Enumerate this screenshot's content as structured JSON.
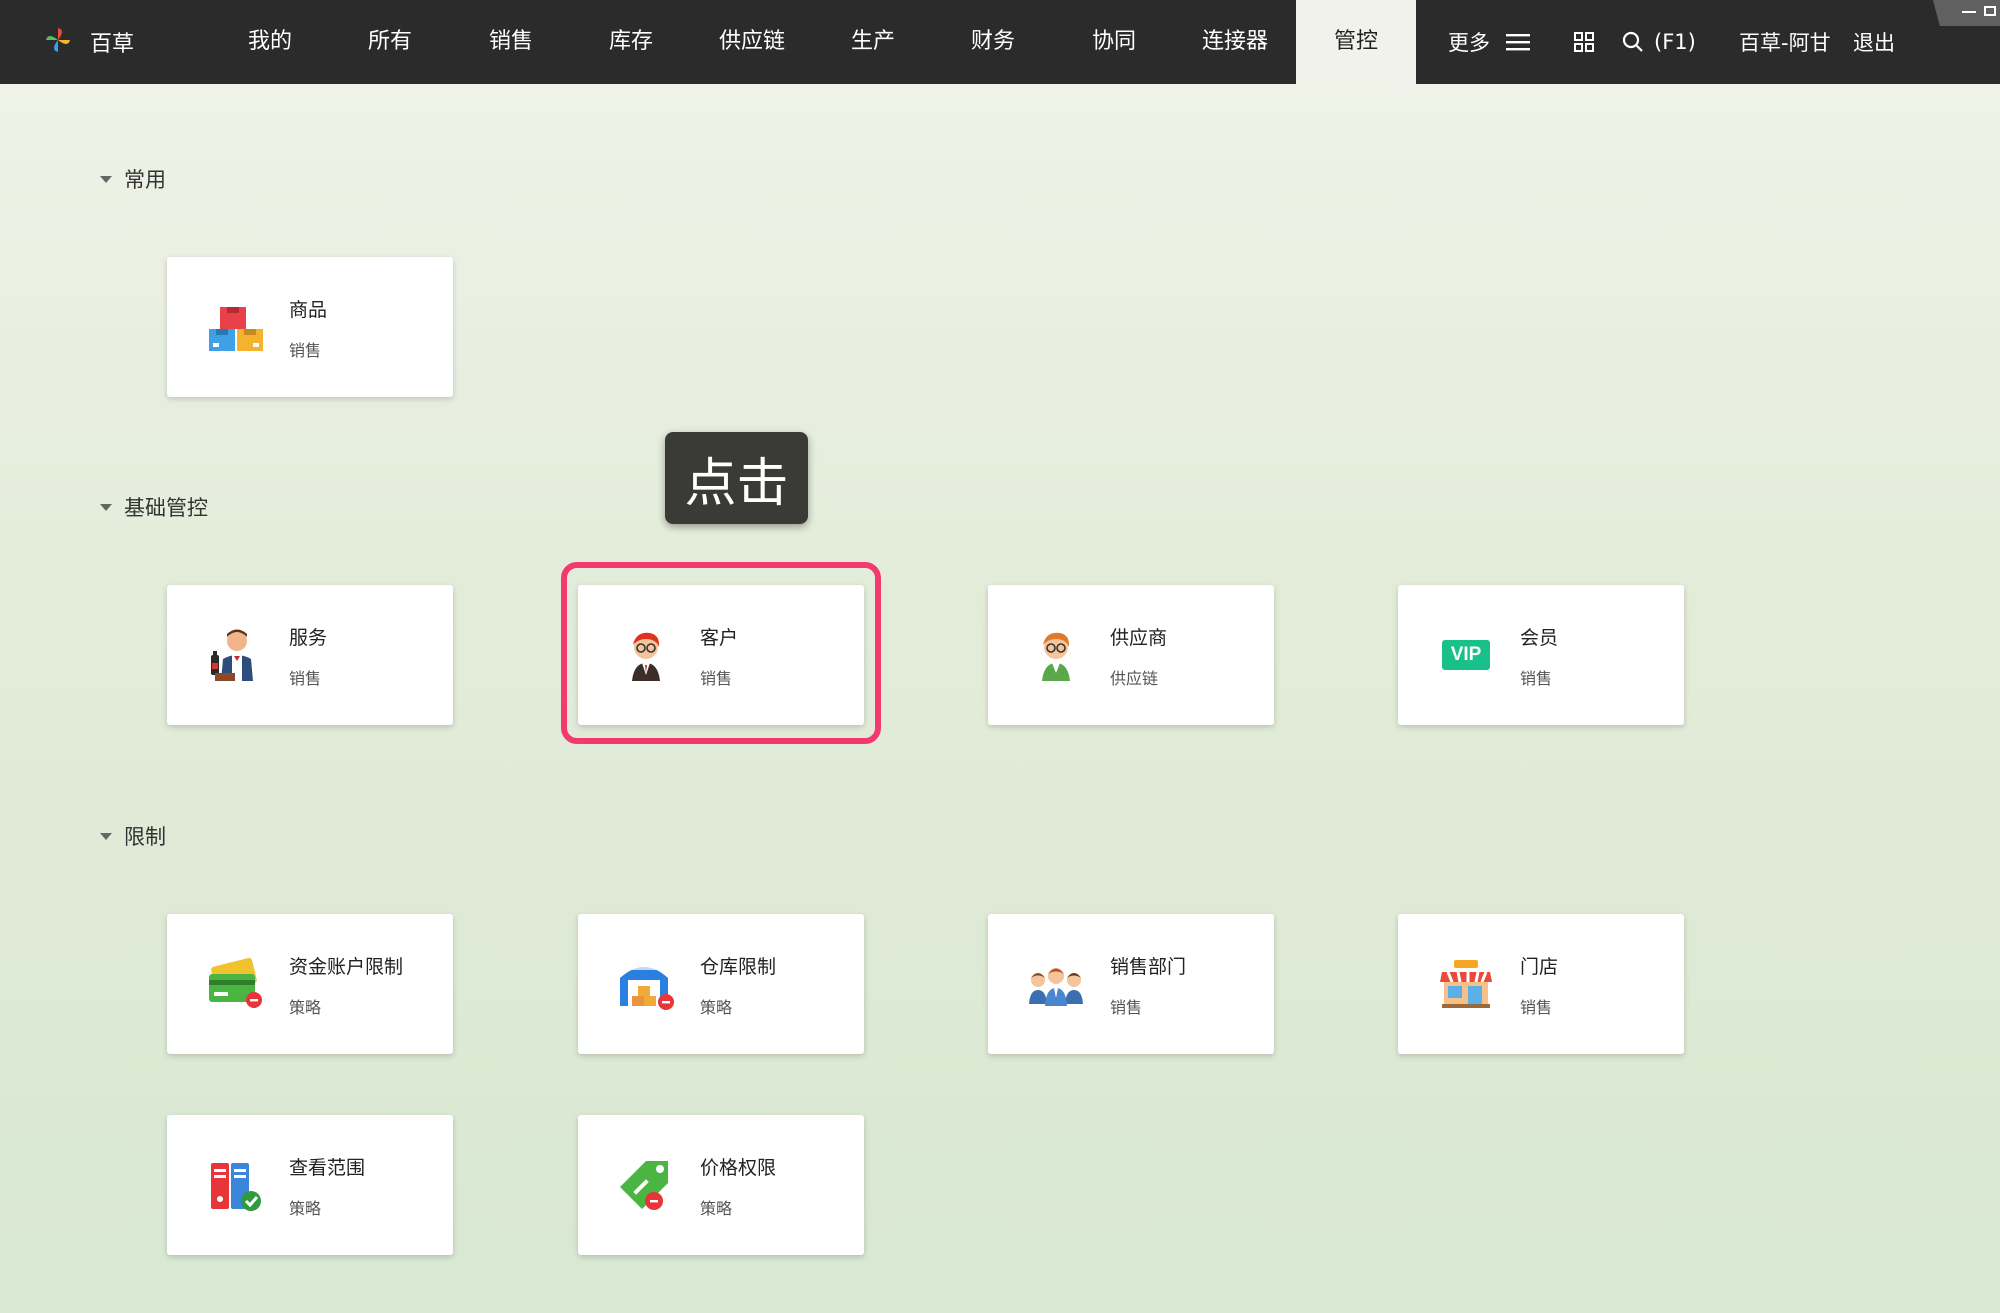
{
  "topbar": {
    "brand": {
      "label": "百草",
      "icon": "pinwheel-logo-icon"
    },
    "nav": [
      {
        "label": "我的"
      },
      {
        "label": "所有"
      },
      {
        "label": "销售"
      },
      {
        "label": "库存"
      },
      {
        "label": "供应链"
      },
      {
        "label": "生产"
      },
      {
        "label": "财务"
      },
      {
        "label": "协同"
      },
      {
        "label": "连接器"
      },
      {
        "label": "管控",
        "active": true
      }
    ],
    "more_label": "更多",
    "search_shortcut": "(F1)",
    "user": "百草-阿甘",
    "logout": "退出"
  },
  "sections": [
    {
      "title": "常用",
      "cards": [
        {
          "title": "商品",
          "sub": "销售",
          "icon": "boxes-icon"
        }
      ]
    },
    {
      "title": "基础管控",
      "cards": [
        {
          "title": "服务",
          "sub": "销售",
          "icon": "waiter-icon"
        },
        {
          "title": "客户",
          "sub": "销售",
          "icon": "customer-avatar-icon",
          "highlighted": true
        },
        {
          "title": "供应商",
          "sub": "供应链",
          "icon": "supplier-avatar-icon"
        },
        {
          "title": "会员",
          "sub": "销售",
          "icon": "vip-icon",
          "badge": "VIP"
        }
      ]
    },
    {
      "title": "限制",
      "cards": [
        {
          "title": "资金账户限制",
          "sub": "策略",
          "icon": "credit-card-icon"
        },
        {
          "title": "仓库限制",
          "sub": "策略",
          "icon": "warehouse-icon"
        },
        {
          "title": "销售部门",
          "sub": "销售",
          "icon": "team-icon"
        },
        {
          "title": "门店",
          "sub": "销售",
          "icon": "shop-icon"
        },
        {
          "title": "查看范围",
          "sub": "策略",
          "icon": "folders-check-icon"
        },
        {
          "title": "价格权限",
          "sub": "策略",
          "icon": "price-tag-icon"
        }
      ]
    }
  ],
  "tooltip": {
    "label": "点击"
  },
  "colors": {
    "topbar": "#2b2b2b",
    "active_tab": "#f2f2ec",
    "highlight": "#f23a6e",
    "vip": "#19c08a"
  }
}
